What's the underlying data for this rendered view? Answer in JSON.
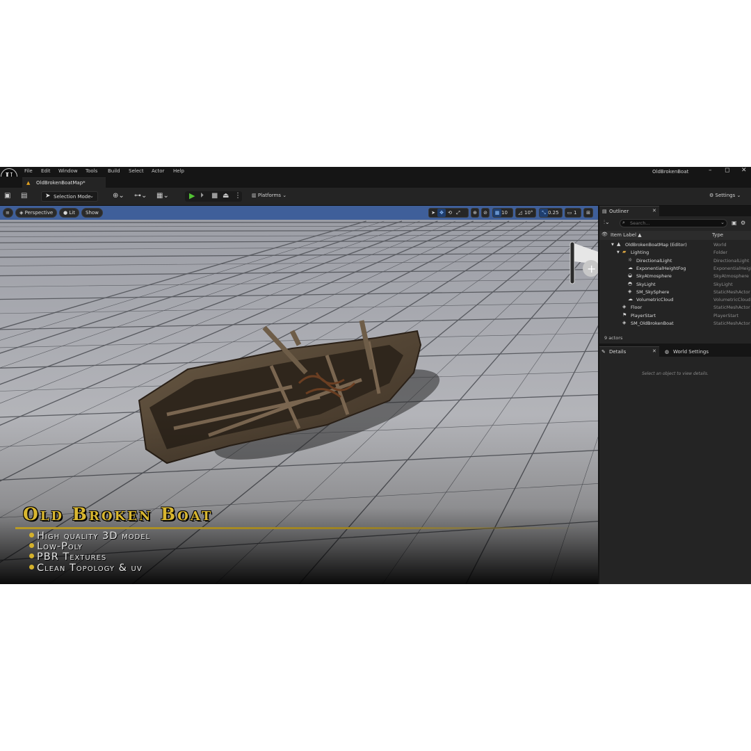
{
  "window": {
    "title": "OldBrokenBoat",
    "logo_letter": "U",
    "controls": {
      "minimize": "–",
      "maximize": "◻",
      "close": "✕"
    }
  },
  "menu": [
    "File",
    "Edit",
    "Window",
    "Tools",
    "Build",
    "Select",
    "Actor",
    "Help"
  ],
  "tab": {
    "label": "OldBrokenBoatMap*"
  },
  "toolbar": {
    "selection_mode": "Selection Mode",
    "platforms": "Platforms",
    "settings": "Settings"
  },
  "viewport": {
    "perspective": "Perspective",
    "lit": "Lit",
    "show": "Show",
    "grid_snap": "10",
    "rotation_snap": "10°",
    "scale_snap": "0.25",
    "camera_speed": "1"
  },
  "overlay": {
    "title": "Old Broken Boat",
    "features": [
      "High quality 3D model",
      "Low-Poly",
      "PBR Textures",
      "Clean Topology & uv"
    ]
  },
  "outliner": {
    "tab_label": "Outliner",
    "search_placeholder": "Search...",
    "col_label": "Item Label ▲",
    "col_type": "Type",
    "rows": [
      {
        "name": "OldBrokenBoatMap (Editor)",
        "type": "World",
        "icon": "▲",
        "indent": 0,
        "arrow": "▼"
      },
      {
        "name": "Lighting",
        "type": "Folder",
        "icon": "▰",
        "indent": 1,
        "arrow": "▼"
      },
      {
        "name": "DirectionalLight",
        "type": "DirectionalLight",
        "icon": "☼",
        "indent": 2,
        "arrow": ""
      },
      {
        "name": "ExponentialHeightFog",
        "type": "ExponentialHeigh",
        "icon": "☁",
        "indent": 2,
        "arrow": ""
      },
      {
        "name": "SkyAtmosphere",
        "type": "SkyAtmosphere",
        "icon": "◒",
        "indent": 2,
        "arrow": ""
      },
      {
        "name": "SkyLight",
        "type": "SkyLight",
        "icon": "◓",
        "indent": 2,
        "arrow": ""
      },
      {
        "name": "SM_SkySphere",
        "type": "StaticMeshActor",
        "icon": "◈",
        "indent": 2,
        "arrow": ""
      },
      {
        "name": "VolumetricCloud",
        "type": "VolumetricCloud",
        "icon": "☁",
        "indent": 2,
        "arrow": ""
      },
      {
        "name": "Floor",
        "type": "StaticMeshActor",
        "icon": "◈",
        "indent": 1,
        "arrow": ""
      },
      {
        "name": "PlayerStart",
        "type": "PlayerStart",
        "icon": "⚑",
        "indent": 1,
        "arrow": ""
      },
      {
        "name": "SM_OldBrokenBoat",
        "type": "StaticMeshActor",
        "icon": "◈",
        "indent": 1,
        "arrow": ""
      }
    ],
    "actor_count": "9 actors"
  },
  "details": {
    "tab_label": "Details",
    "world_settings_label": "World Settings",
    "hint": "Select an object to view details."
  },
  "colors": {
    "accent_title": "#d8b630",
    "editor_bg": "#151515",
    "panel_bg": "#242424",
    "play_green": "#52c234",
    "sky_blue": "#3f5f9a"
  }
}
